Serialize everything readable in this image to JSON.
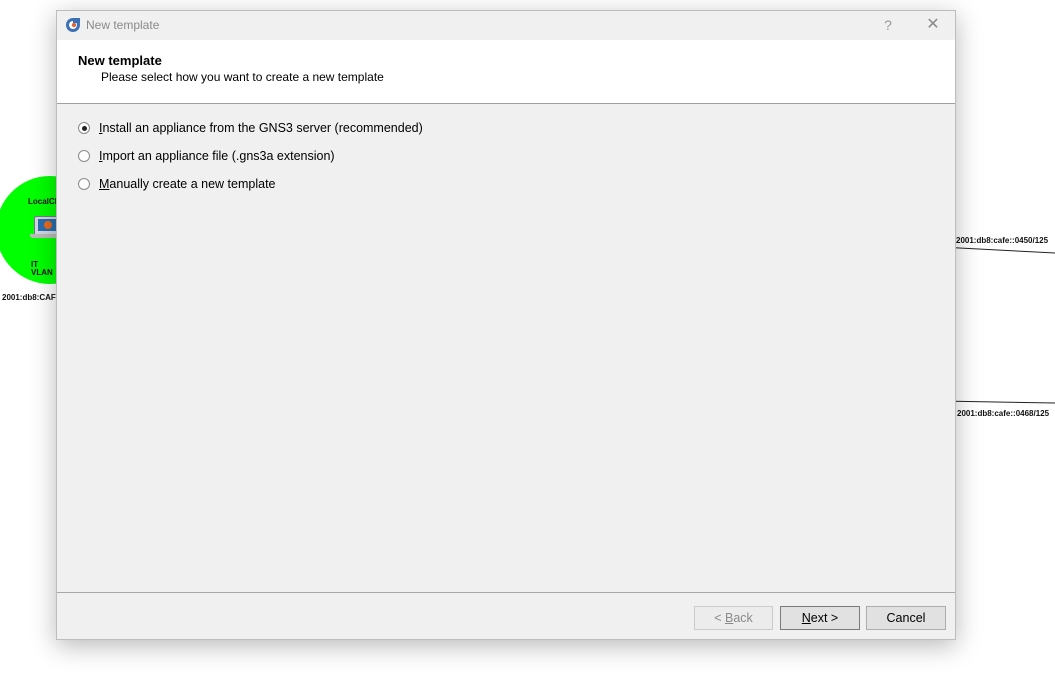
{
  "dialog": {
    "title": "New template",
    "help_glyph": "?",
    "close_glyph": "✕",
    "heading": "New template",
    "subheading": "Please select how you want to create a new template",
    "options": [
      {
        "first": "I",
        "rest": "nstall an appliance from the GNS3 server (recommended)",
        "checked": true
      },
      {
        "first": "I",
        "rest": "mport an appliance file (.gns3a extension)",
        "checked": false
      },
      {
        "first": "M",
        "rest": "anually create a new template",
        "checked": false
      }
    ],
    "buttons": {
      "back_prefix": "< ",
      "back_mnemonic": "B",
      "back_rest": "ack",
      "next_mnemonic": "N",
      "next_rest": "ext >",
      "cancel": "Cancel"
    }
  },
  "background": {
    "node": {
      "name_partial": "LocalCl",
      "line1": "IT",
      "line2": "VLAN",
      "address": "2001:db8:CAF"
    },
    "link_labels": [
      "2001:db8:cafe::0450/125",
      "2001:db8:cafe::0468/125"
    ],
    "node_color": "#00ff00"
  }
}
